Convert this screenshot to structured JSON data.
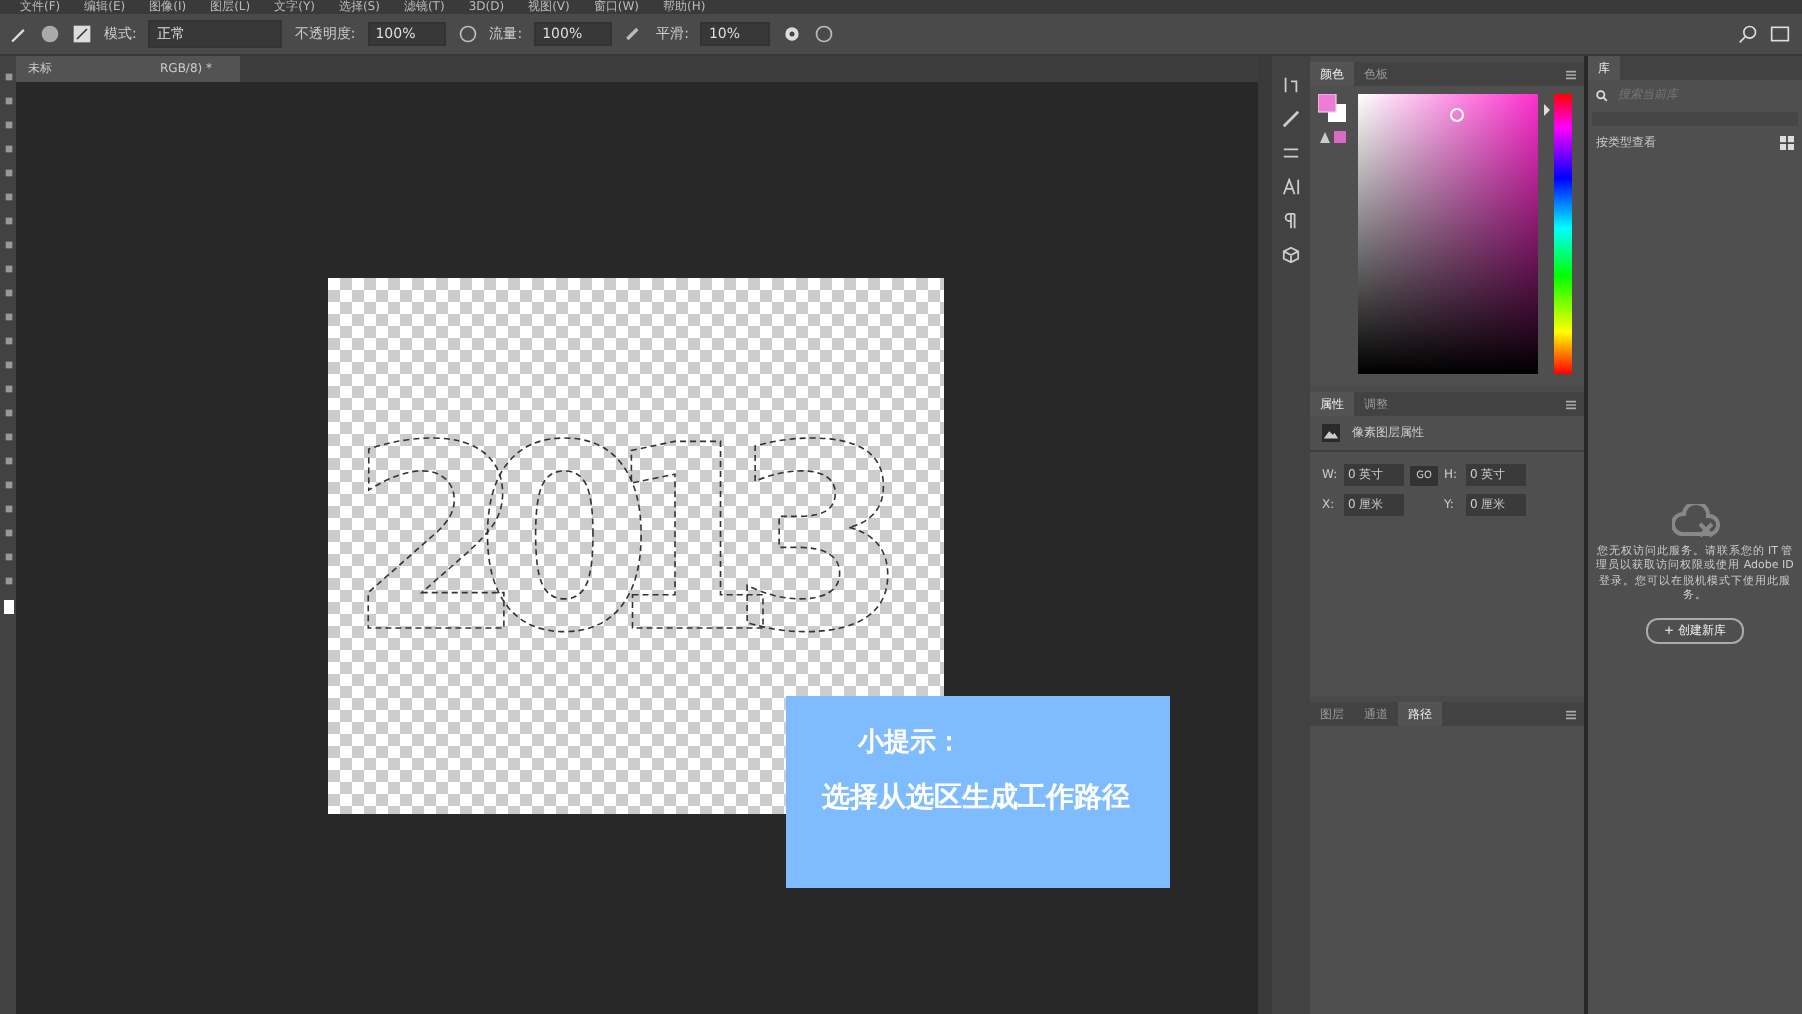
{
  "menu_bar": {
    "items": [
      "文件(F)",
      "编辑(E)",
      "图像(I)",
      "图层(L)",
      "文字(Y)",
      "选择(S)",
      "滤镜(T)",
      "3D(D)",
      "视图(V)",
      "窗口(W)",
      "帮助(H)"
    ]
  },
  "options_bar": {
    "mode_label": "模式:",
    "mode_value": "正常",
    "opacity_label": "不透明度:",
    "opacity_value": "100%",
    "flow_label": "流量:",
    "flow_value": "100%",
    "smoothing_label": "平滑:",
    "smoothing_value": "10%"
  },
  "document": {
    "tab_title_start": "未标",
    "tab_title_end": "RGB/8) *",
    "selection_text": "2013"
  },
  "tip": {
    "title": "小提示：",
    "text": "选择从选区生成工作路径"
  },
  "color_panel": {
    "tabs": [
      {
        "label": "颜色",
        "selected": true
      },
      {
        "label": "色板",
        "selected": false
      }
    ],
    "hue_slider": {
      "level": 0.06
    }
  },
  "properties_panel": {
    "tabs": [
      {
        "label": "属性",
        "selected": true
      },
      {
        "label": "调整",
        "selected": false
      }
    ],
    "layer_type": "像素图层属性",
    "fields": [
      {
        "label": "W:",
        "value": "0 英寸"
      },
      {
        "label": "H:",
        "value": "0 英寸"
      },
      {
        "label": "X:",
        "value": "0 厘米"
      },
      {
        "label": "Y:",
        "value": "0 厘米"
      }
    ],
    "link_label": "GO"
  },
  "layers_panel": {
    "tabs": [
      {
        "label": "图层",
        "selected": false
      },
      {
        "label": "通道",
        "selected": false
      },
      {
        "label": "路径",
        "selected": true
      }
    ]
  },
  "library_panel": {
    "tab": "库",
    "search_placeholder": "搜索当前库",
    "view_label": "按类型查看",
    "message": "您无权访问此服务。请联系您的 IT 管理员以获取访问权限或使用 Adobe ID 登录。您可以在脱机模式下使用此服务。",
    "create_button": "+ 创建新库"
  }
}
